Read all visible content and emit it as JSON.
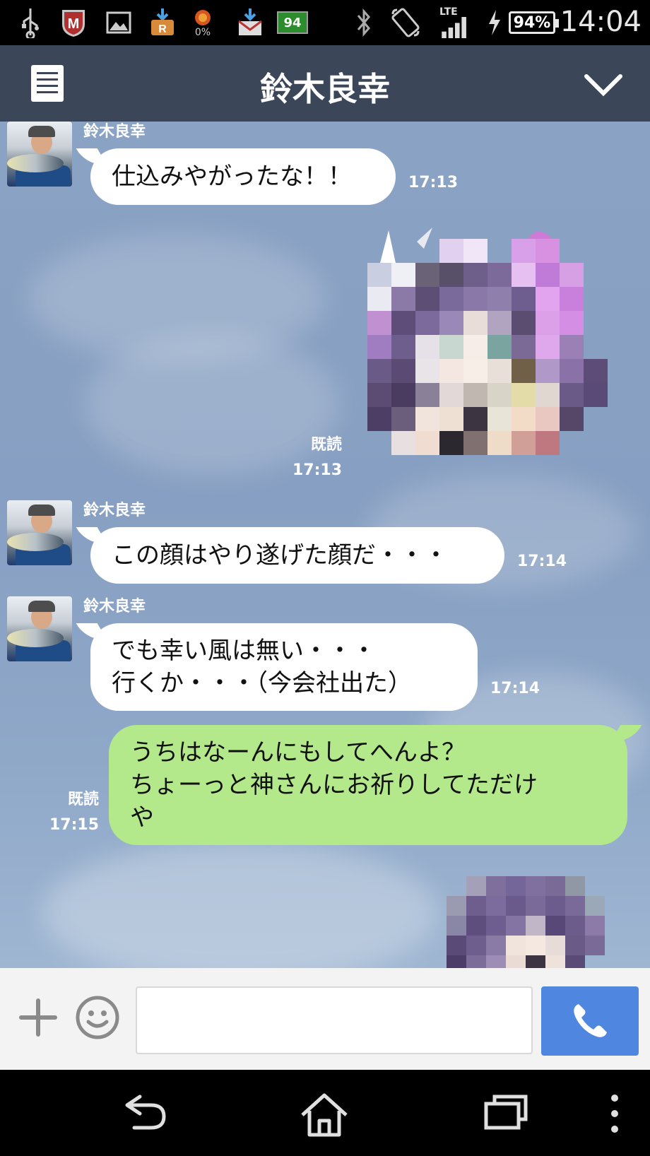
{
  "status_bar": {
    "time": "14:04",
    "battery": "94%",
    "network": "LTE",
    "notification_badge": "94",
    "storage_percent": "0%",
    "icons": [
      "usb-icon",
      "mcafee-icon",
      "image-icon",
      "download-r-icon",
      "flame-icon",
      "mail-download-icon",
      "notification-94-icon",
      "bluetooth-icon",
      "rotate-icon",
      "signal-icon",
      "charging-icon",
      "battery-icon"
    ]
  },
  "header": {
    "title": "鈴木良幸",
    "left_icon": "menu-icon",
    "right_icon": "chevron-down-icon",
    "bg_color": "#3b4658"
  },
  "messages": [
    {
      "type": "incoming",
      "sender": "鈴木良幸",
      "text": "仕込みやがったな！！",
      "time": "17:13"
    },
    {
      "type": "outgoing-sticker",
      "read": "既読",
      "time": "17:13"
    },
    {
      "type": "incoming",
      "sender": "鈴木良幸",
      "text": "この顔はやり遂げた顔だ・・・",
      "time": "17:14"
    },
    {
      "type": "incoming",
      "sender": "鈴木良幸",
      "lines": [
        "でも幸い風は無い・・・",
        "行くか・・・（今会社出た）"
      ],
      "time": "17:14"
    },
    {
      "type": "outgoing",
      "lines": [
        "うちはなーんにもしてへんよ？",
        "ちょーっと神さんにお祈りしてただけ",
        "や"
      ],
      "read": "既読",
      "time": "17:15"
    },
    {
      "type": "outgoing-sticker-partial"
    }
  ],
  "input_bar": {
    "plus_icon": "plus-icon",
    "emoji_icon": "emoji-icon",
    "message_value": "",
    "call_icon": "phone-icon",
    "call_color": "#4f86e0"
  },
  "nav_bar": {
    "icons": [
      "back-icon",
      "home-icon",
      "recent-apps-icon",
      "overflow-menu-icon"
    ]
  },
  "colors": {
    "incoming_bubble": "#ffffff",
    "outgoing_bubble": "#b3e98b",
    "chat_background": "#8aa2c3"
  }
}
